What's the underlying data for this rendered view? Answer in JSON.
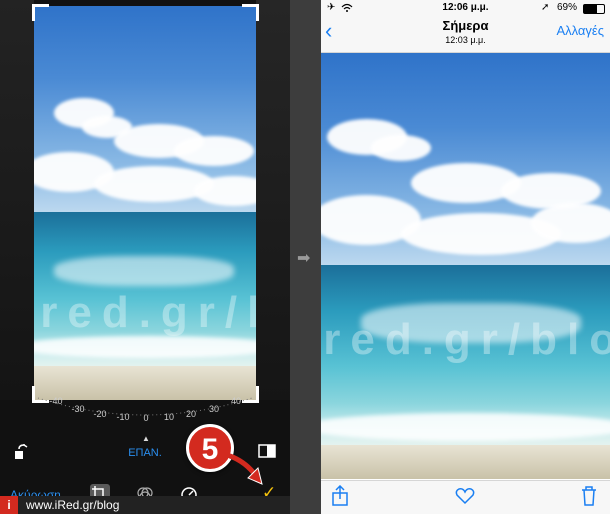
{
  "editor": {
    "dial_ticks": [
      "-40",
      "-30",
      "-20",
      "-10",
      "0",
      "10",
      "20",
      "30",
      "40"
    ],
    "revert_label": "ΕΠΑΝ.",
    "cancel_label": "Ακύρωση",
    "done_icon": "✓",
    "step_number": "5"
  },
  "watermark": {
    "logo": "i",
    "text": "www.iRed.gr/blog",
    "overlay": "ired.gr/blog"
  },
  "photos": {
    "status": {
      "time": "12:06 μ.μ.",
      "battery": "69%"
    },
    "nav": {
      "title": "Σήμερα",
      "subtitle": "12:03 μ.μ.",
      "edit_label": "Αλλαγές"
    }
  },
  "colors": {
    "accent": "#1a7ff2",
    "done": "#f4c20d",
    "badge": "#d32a1f"
  }
}
